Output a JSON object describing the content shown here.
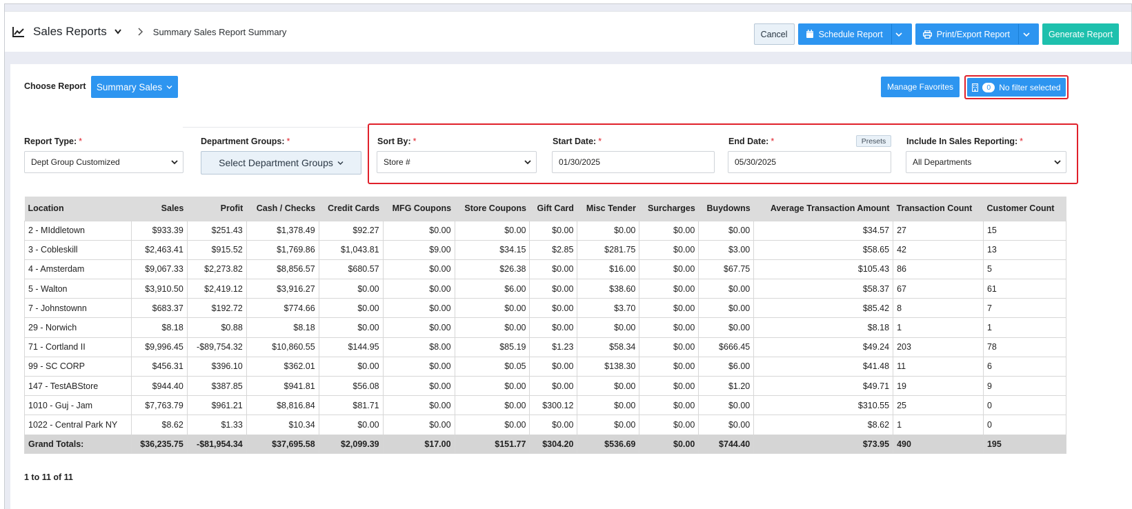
{
  "header": {
    "app_title": "Sales Reports",
    "breadcrumb": "Summary Sales Report Summary",
    "cancel_label": "Cancel",
    "schedule_label": "Schedule Report",
    "print_label": "Print/Export Report",
    "generate_label": "Generate Report"
  },
  "choose": {
    "label": "Choose Report",
    "selected": "Summary Sales",
    "manage_favorites": "Manage Favorites",
    "filter_count": "0",
    "filter_label": "No filter selected"
  },
  "form": {
    "report_type_label": "Report Type:",
    "report_type_value": "Dept Group Customized",
    "dept_groups_label": "Department Groups:",
    "dept_groups_button": "Select Department Groups",
    "sort_by_label": "Sort By:",
    "sort_by_value": "Store #",
    "start_date_label": "Start Date:",
    "start_date_value": "01/30/2025",
    "end_date_label": "End Date:",
    "end_date_value": "05/30/2025",
    "presets_label": "Presets",
    "include_label": "Include In Sales Reporting:",
    "include_value": "All Departments",
    "required_mark": "*"
  },
  "table": {
    "columns": [
      "Location",
      "Sales",
      "Profit",
      "Cash / Checks",
      "Credit Cards",
      "MFG Coupons",
      "Store Coupons",
      "Gift Card",
      "Misc Tender",
      "Surcharges",
      "Buydowns",
      "Average Transaction Amount",
      "Transaction Count",
      "Customer Count"
    ],
    "rows": [
      [
        "2 - MIddletown",
        "$933.39",
        "$251.43",
        "$1,378.49",
        "$92.27",
        "$0.00",
        "$0.00",
        "$0.00",
        "$0.00",
        "$0.00",
        "$0.00",
        "$34.57",
        "27",
        "15"
      ],
      [
        "3 - Cobleskill",
        "$2,463.41",
        "$915.52",
        "$1,769.86",
        "$1,043.81",
        "$9.00",
        "$34.15",
        "$2.85",
        "$281.75",
        "$0.00",
        "$3.00",
        "$58.65",
        "42",
        "13"
      ],
      [
        "4 - Amsterdam",
        "$9,067.33",
        "$2,273.82",
        "$8,856.57",
        "$680.57",
        "$0.00",
        "$26.38",
        "$0.00",
        "$16.00",
        "$0.00",
        "$67.75",
        "$105.43",
        "86",
        "5"
      ],
      [
        "5 - Walton",
        "$3,910.50",
        "$2,419.12",
        "$3,916.27",
        "$0.00",
        "$0.00",
        "$6.00",
        "$0.00",
        "$38.60",
        "$0.00",
        "$0.00",
        "$58.37",
        "67",
        "61"
      ],
      [
        "7 - Johnstownn",
        "$683.37",
        "$192.72",
        "$774.66",
        "$0.00",
        "$0.00",
        "$0.00",
        "$0.00",
        "$3.70",
        "$0.00",
        "$0.00",
        "$85.42",
        "8",
        "7"
      ],
      [
        "29 - Norwich",
        "$8.18",
        "$0.88",
        "$8.18",
        "$0.00",
        "$0.00",
        "$0.00",
        "$0.00",
        "$0.00",
        "$0.00",
        "$0.00",
        "$8.18",
        "1",
        "1"
      ],
      [
        "71 - Cortland II",
        "$9,996.45",
        "-$89,754.32",
        "$10,860.55",
        "$144.95",
        "$8.00",
        "$85.19",
        "$1.23",
        "$58.34",
        "$0.00",
        "$666.45",
        "$49.24",
        "203",
        "78"
      ],
      [
        "99 - SC CORP",
        "$456.31",
        "$396.10",
        "$362.01",
        "$0.00",
        "$0.00",
        "$0.05",
        "$0.00",
        "$138.30",
        "$0.00",
        "$6.00",
        "$41.48",
        "11",
        "6"
      ],
      [
        "147 - TestABStore",
        "$944.40",
        "$387.85",
        "$941.81",
        "$56.08",
        "$0.00",
        "$0.00",
        "$0.00",
        "$0.00",
        "$0.00",
        "$1.20",
        "$49.71",
        "19",
        "9"
      ],
      [
        "1010 - Guj - Jam",
        "$7,763.79",
        "$961.21",
        "$8,816.84",
        "$81.71",
        "$0.00",
        "$0.00",
        "$300.12",
        "$0.00",
        "$0.00",
        "$0.00",
        "$310.55",
        "25",
        "0"
      ],
      [
        "1022 - Central Park NY",
        "$8.62",
        "$1.33",
        "$10.34",
        "$0.00",
        "$0.00",
        "$0.00",
        "$0.00",
        "$0.00",
        "$0.00",
        "$0.00",
        "$8.62",
        "1",
        "0"
      ]
    ],
    "totals": [
      "Grand Totals:",
      "$36,235.75",
      "-$81,954.34",
      "$37,695.58",
      "$2,099.39",
      "$17.00",
      "$151.77",
      "$304.20",
      "$536.69",
      "$0.00",
      "$744.40",
      "$73.95",
      "490",
      "195"
    ]
  },
  "pager": "1 to 11 of 11",
  "colors": {
    "primary": "#2d95f0",
    "teal": "#1ec0ad",
    "highlight": "#e0202a"
  }
}
